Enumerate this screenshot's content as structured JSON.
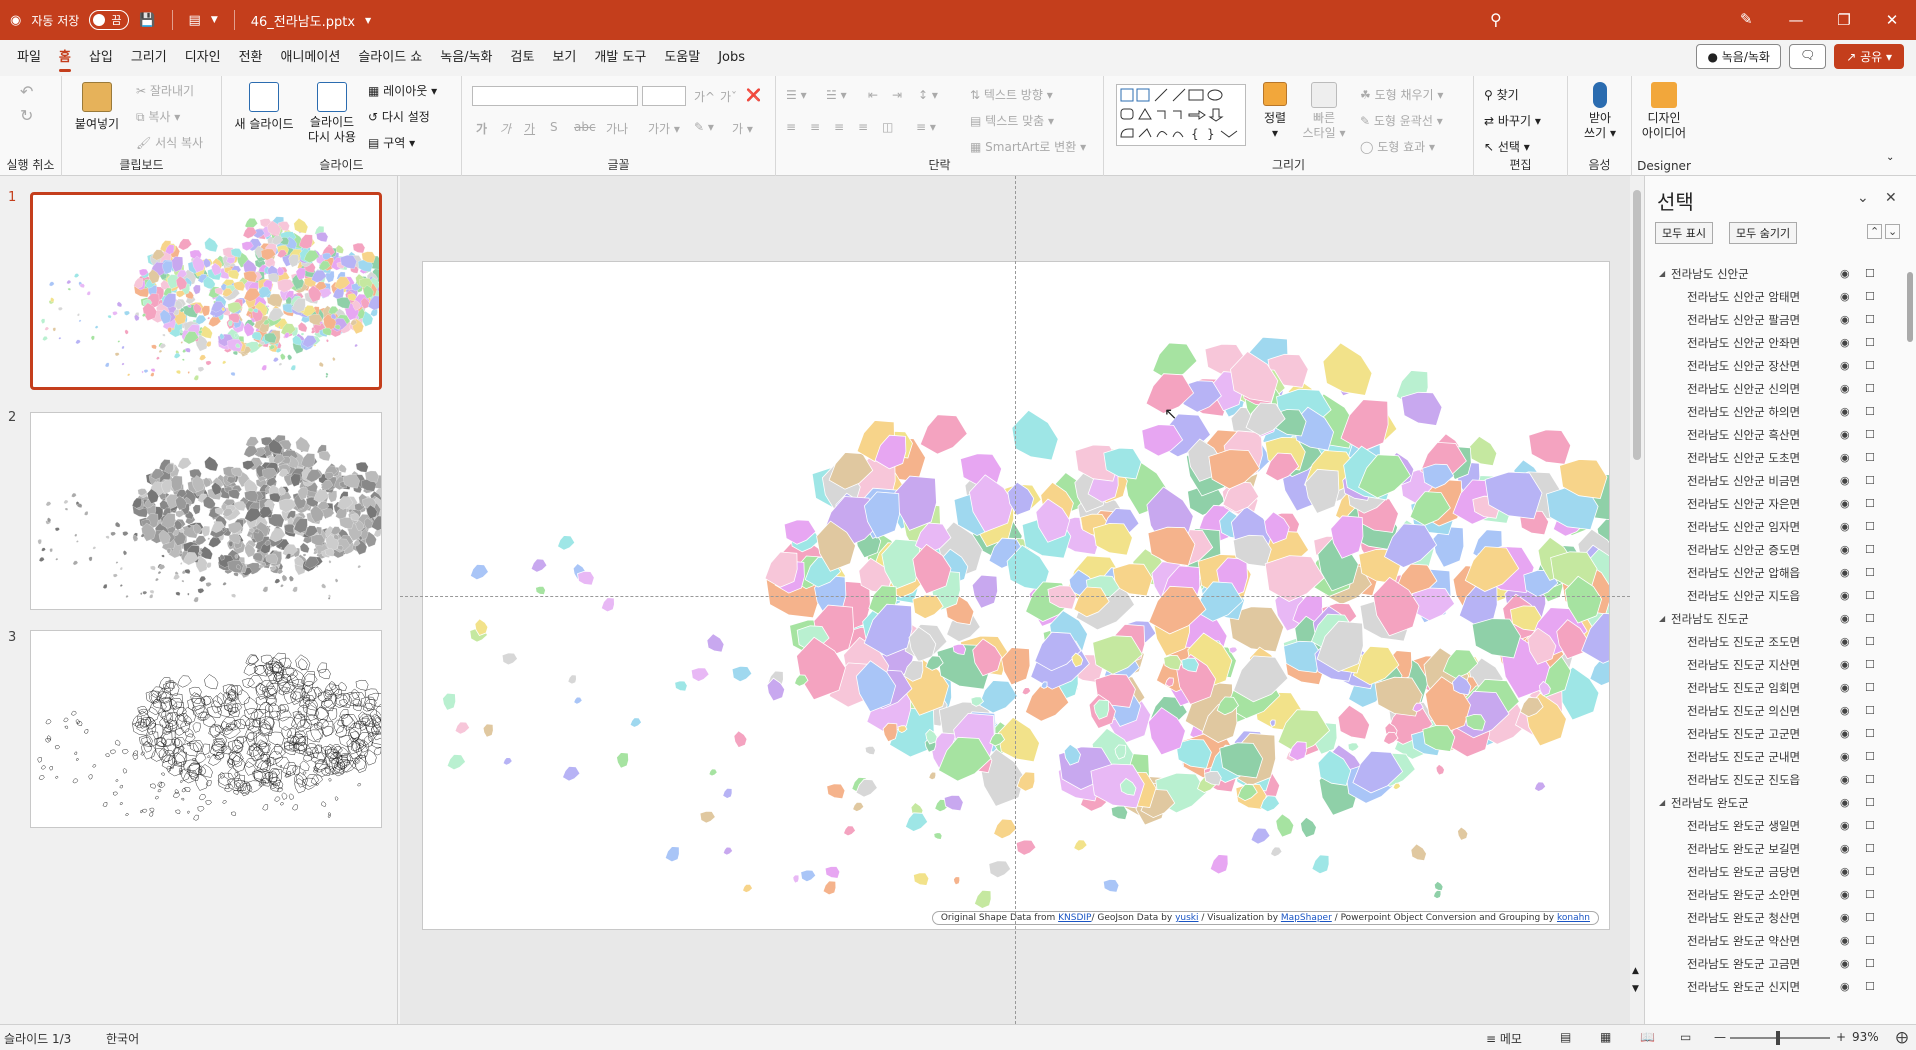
{
  "titlebar": {
    "autosave_label": "자동 저장",
    "autosave_state": "끔",
    "file_name": "46_전라남도.pptx",
    "icons": [
      "powerpoint-logo-icon",
      "save-icon",
      "presentation-icon",
      "customize-icon",
      "search-icon",
      "pen-icon",
      "minimize-icon",
      "restore-icon",
      "close-icon"
    ]
  },
  "menu": {
    "items": [
      "파일",
      "홈",
      "삽입",
      "그리기",
      "디자인",
      "전환",
      "애니메이션",
      "슬라이드 쇼",
      "녹음/녹화",
      "검토",
      "보기",
      "개발 도구",
      "도움말",
      "Jobs"
    ],
    "active": "홈",
    "record_label": "녹음/녹화",
    "share_label": "공유"
  },
  "ribbon": {
    "undo_label": "실행 취소",
    "clipboard": {
      "paste": "붙여넣기",
      "cut": "잘라내기",
      "copy": "복사",
      "format_painter": "서식 복사",
      "label": "클립보드"
    },
    "slides": {
      "new_slide": "새 슬라이드",
      "reuse_line1": "슬라이드",
      "reuse_line2": "다시 사용",
      "layout": "레이아웃",
      "reset": "다시 설정",
      "section": "구역",
      "label": "슬라이드"
    },
    "font": {
      "label": "글꼴",
      "bold": "가",
      "italic": "가",
      "underline": "가",
      "strike": "S",
      "spacing": "가나"
    },
    "paragraph": {
      "label": "단락",
      "text_direction": "텍스트 방향",
      "align_text": "텍스트 맞춤",
      "smartart": "SmartArt로 변환"
    },
    "drawing": {
      "label": "그리기",
      "arrange": "정렬",
      "quick_styles_line1": "빠른",
      "quick_styles_line2": "스타일",
      "fill": "도형 채우기",
      "outline": "도형 윤곽선",
      "effects": "도형 효과"
    },
    "editing": {
      "label": "편집",
      "find": "찾기",
      "replace": "바꾸기",
      "select": "선택"
    },
    "voice": {
      "label": "음성",
      "dictate_line1": "받아",
      "dictate_line2": "쓰기"
    },
    "designer": {
      "label": "Designer",
      "ideas_line1": "디자인",
      "ideas_line2": "아이디어"
    }
  },
  "thumbnails": [
    {
      "number": "1",
      "style": "color"
    },
    {
      "number": "2",
      "style": "gray"
    },
    {
      "number": "3",
      "style": "outline"
    }
  ],
  "slide": {
    "credit": {
      "prefix": "Original Shape Data from",
      "link1": "KNSDIP",
      "mid1": "/ GeoJson Data by",
      "link2": "yuski",
      "mid2": "/ Visualization  by",
      "link3": "MapShaper",
      "mid3": "/ Powerpoint Object Conversion and Grouping  by",
      "link4": "konahn"
    }
  },
  "selection_pane": {
    "title": "선택",
    "show_all": "모두 표시",
    "hide_all": "모두 숨기기",
    "items": [
      {
        "label": "전라남도 신안군",
        "level": 0
      },
      {
        "label": "전라남도 신안군 암태면",
        "level": 1
      },
      {
        "label": "전라남도 신안군 팔금면",
        "level": 1
      },
      {
        "label": "전라남도 신안군 안좌면",
        "level": 1
      },
      {
        "label": "전라남도 신안군 장산면",
        "level": 1
      },
      {
        "label": "전라남도 신안군 신의면",
        "level": 1
      },
      {
        "label": "전라남도 신안군 하의면",
        "level": 1
      },
      {
        "label": "전라남도 신안군 흑산면",
        "level": 1
      },
      {
        "label": "전라남도 신안군 도초면",
        "level": 1
      },
      {
        "label": "전라남도 신안군 비금면",
        "level": 1
      },
      {
        "label": "전라남도 신안군 자은면",
        "level": 1
      },
      {
        "label": "전라남도 신안군 임자면",
        "level": 1
      },
      {
        "label": "전라남도 신안군 증도면",
        "level": 1
      },
      {
        "label": "전라남도 신안군 압해읍",
        "level": 1
      },
      {
        "label": "전라남도 신안군 지도읍",
        "level": 1
      },
      {
        "label": "전라남도 진도군",
        "level": 0
      },
      {
        "label": "전라남도 진도군 조도면",
        "level": 1
      },
      {
        "label": "전라남도 진도군 지산면",
        "level": 1
      },
      {
        "label": "전라남도 진도군 임회면",
        "level": 1
      },
      {
        "label": "전라남도 진도군 의신면",
        "level": 1
      },
      {
        "label": "전라남도 진도군 고군면",
        "level": 1
      },
      {
        "label": "전라남도 진도군 군내면",
        "level": 1
      },
      {
        "label": "전라남도 진도군 진도읍",
        "level": 1
      },
      {
        "label": "전라남도 완도군",
        "level": 0
      },
      {
        "label": "전라남도 완도군 생일면",
        "level": 1
      },
      {
        "label": "전라남도 완도군 보길면",
        "level": 1
      },
      {
        "label": "전라남도 완도군 금당면",
        "level": 1
      },
      {
        "label": "전라남도 완도군 소안면",
        "level": 1
      },
      {
        "label": "전라남도 완도군 청산면",
        "level": 1
      },
      {
        "label": "전라남도 완도군 약산면",
        "level": 1
      },
      {
        "label": "전라남도 완도군 고금면",
        "level": 1
      },
      {
        "label": "전라남도 완도군 신지면",
        "level": 1
      }
    ]
  },
  "status": {
    "slide_counter": "슬라이드 1/3",
    "language": "한국어",
    "notes": "메모",
    "zoom": "93%"
  },
  "colors": {
    "brand": "#c43e1c"
  }
}
